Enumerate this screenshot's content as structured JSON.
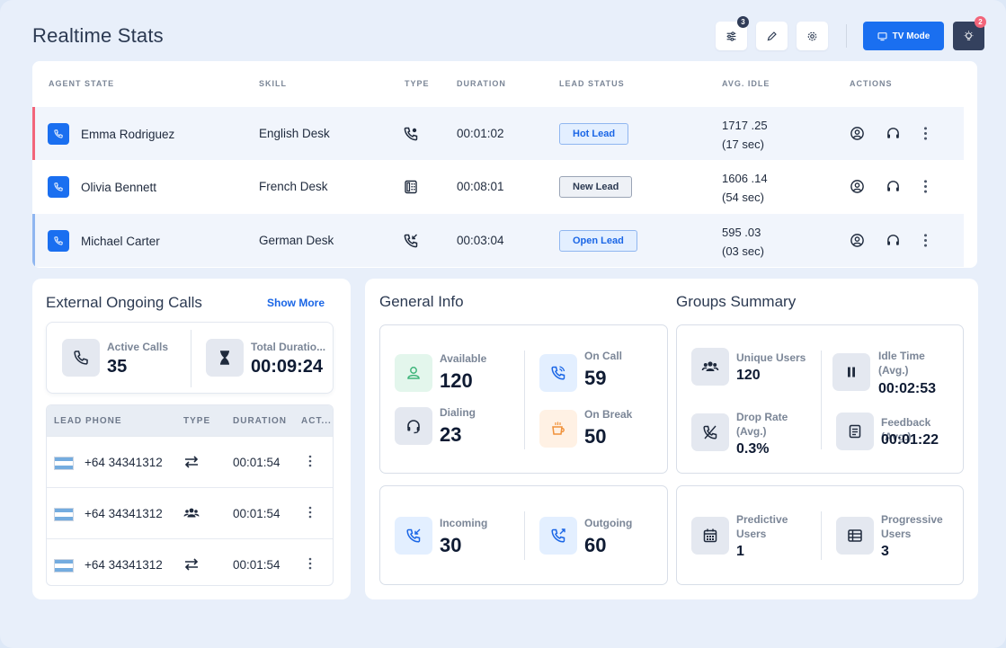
{
  "header": {
    "title": "Realtime Stats",
    "filter_badge": "3",
    "tv_mode_label": "TV Mode",
    "notif_badge": "2",
    "accent_color": "#1a6ff0"
  },
  "agents_table": {
    "columns": [
      "AGENT STATE",
      "SKILL",
      "TYPE",
      "DURATION",
      "LEAD STATUS",
      "AVG. IDLE",
      "ACTIONS"
    ],
    "rows": [
      {
        "name": "Emma Rodriguez",
        "skill": "English Desk",
        "type_icon": "phone-in-talk-icon",
        "duration": "00:01:02",
        "lead_status": "Hot Lead",
        "idle_value": "1717 .25",
        "idle_sec": "(17 sec)",
        "stripe_color": "#f2657a"
      },
      {
        "name": "Olivia Bennett",
        "skill": "French Desk",
        "type_icon": "fax-icon",
        "duration": "00:08:01",
        "lead_status": "New Lead",
        "idle_value": "1606 .14",
        "idle_sec": "(54 sec)",
        "stripe_color": ""
      },
      {
        "name": "Michael Carter",
        "skill": "German Desk",
        "type_icon": "phone-callback-icon",
        "duration": "00:03:04",
        "lead_status": "Open Lead",
        "idle_value": "595 .03",
        "idle_sec": "(03 sec)",
        "stripe_color": "#8fb6f0"
      }
    ]
  },
  "external_calls": {
    "title": "External Ongoing Calls",
    "show_more": "Show More",
    "active_calls_label": "Active Calls",
    "active_calls_value": "35",
    "total_duration_label": "Total Duratio...",
    "total_duration_value": "00:09:24",
    "columns": [
      "LEAD PHONE",
      "TYPE",
      "DURATION",
      "ACT..."
    ],
    "rows": [
      {
        "phone": "+64 34341312",
        "type_icon": "transfer-icon",
        "duration": "00:01:54"
      },
      {
        "phone": "+64 34341312",
        "type_icon": "group-icon",
        "duration": "00:01:54"
      },
      {
        "phone": "+64 34341312",
        "type_icon": "transfer-icon",
        "duration": "00:01:54"
      }
    ]
  },
  "general_info": {
    "title": "General Info",
    "available_label": "Available",
    "available_value": "120",
    "on_call_label": "On Call",
    "on_call_value": "59",
    "dialing_label": "Dialing",
    "dialing_value": "23",
    "on_break_label": "On Break",
    "on_break_value": "50",
    "incoming_label": "Incoming",
    "incoming_value": "30",
    "outgoing_label": "Outgoing",
    "outgoing_value": "60"
  },
  "groups_summary": {
    "title": "Groups Summary",
    "unique_users_label": "Unique Users",
    "unique_users_value": "120",
    "idle_time_label": "Idle Time (Avg.)",
    "idle_time_value": "00:02:53",
    "drop_rate_label": "Drop Rate (Avg.)",
    "drop_rate_value": "0.3%",
    "feedback_label": "Feedback (Avg.)",
    "feedback_value": "00:01:22",
    "predictive_label": "Predictive Users",
    "predictive_value": "1",
    "progressive_label": "Progressive Users",
    "progressive_value": "3"
  }
}
